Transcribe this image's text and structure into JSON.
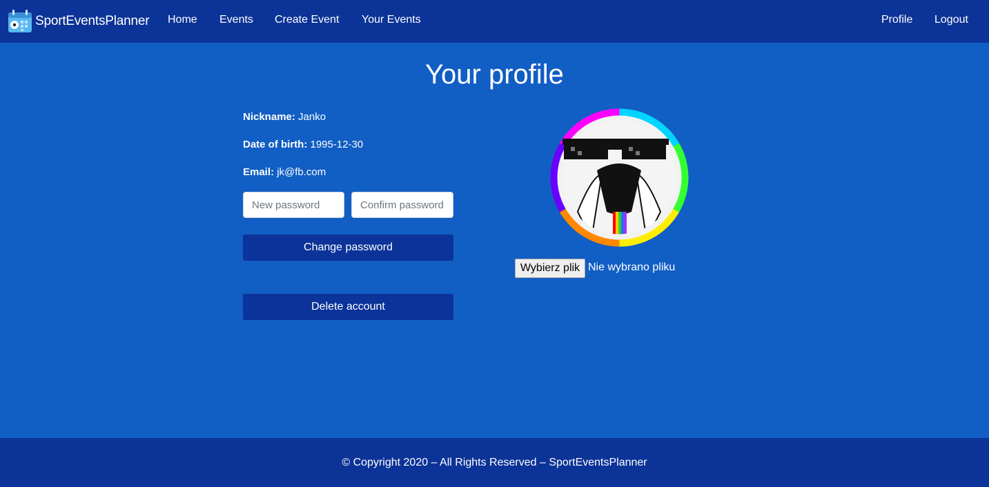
{
  "nav": {
    "brand": "SportEventsPlanner",
    "brand_icon": "calendar-soccer-icon",
    "links": [
      "Home",
      "Events",
      "Create Event",
      "Your Events"
    ],
    "right_links": [
      "Profile",
      "Logout"
    ]
  },
  "profile": {
    "title": "Your profile",
    "nickname_label": "Nickname:",
    "nickname": "Janko",
    "dob_label": "Date of birth:",
    "dob": "1995-12-30",
    "email_label": "Email:",
    "email": "jk@fb.com",
    "new_password_placeholder": "New password",
    "confirm_password_placeholder": "Confirm password",
    "change_password_label": "Change password",
    "delete_account_label": "Delete account"
  },
  "avatar": {
    "icon": "deal-with-it-ghost-avatar",
    "file_button_label": "Wybierz plik",
    "file_status": "Nie wybrano pliku"
  },
  "footer": {
    "text": "© Copyright 2020 – All Rights Reserved – SportEventsPlanner"
  },
  "colors": {
    "background": "#115ec4",
    "navbar": "#0c3397",
    "button": "#0b3399"
  }
}
